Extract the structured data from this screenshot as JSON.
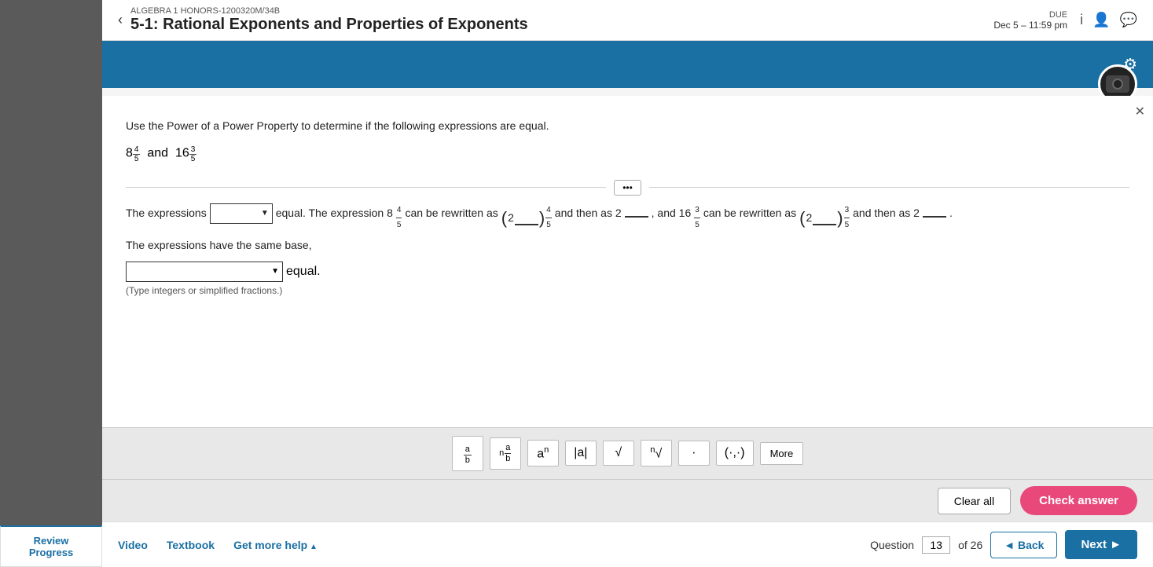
{
  "header": {
    "back_arrow": "‹",
    "subtitle": "ALGEBRA 1 HONORS-1200320M/34B",
    "title": "5-1: Rational Exponents and Properties of Exponents",
    "due_label": "DUE",
    "due_date": "Dec 5 – 11:59 pm"
  },
  "icons": {
    "info": "i",
    "profile": "👤",
    "chat": "💬",
    "gear": "⚙",
    "close": "✕"
  },
  "problem": {
    "instruction": "Use the Power of a Power Property to determine if the following expressions are equal.",
    "expression": "8^(4/5) and 16^(3/5)",
    "expression_base1": "8",
    "expression_exp1_num": "4",
    "expression_exp1_den": "5",
    "expression_and": "and",
    "expression_base2": "16",
    "expression_exp2_num": "3",
    "expression_exp2_den": "5",
    "sentence_start": "The expressions",
    "equal_label": "equal. The expression 8",
    "rewritten_label": "can be rewritten as",
    "paren_base1": "2",
    "then_as": "and then as 2",
    "and_label": ", and 16",
    "rewritten_label2": "can be rewritten as",
    "paren_base2": "2",
    "then_as2": "and then as 2",
    "same_base_note": "The expressions have the same base,",
    "second_dropdown_label": "equal.",
    "type_note": "(Type integers or simplified fractions.)"
  },
  "toolbar": {
    "buttons": [
      {
        "id": "fraction",
        "symbol": "⁴⁄₅",
        "label": "fraction"
      },
      {
        "id": "mixed",
        "symbol": "⁴⁄₅ₙ",
        "label": "mixed-number"
      },
      {
        "id": "superscript",
        "symbol": "aⁿ",
        "label": "superscript"
      },
      {
        "id": "abs",
        "symbol": "|a|",
        "label": "absolute-value"
      },
      {
        "id": "sqrt",
        "symbol": "√",
        "label": "square-root"
      },
      {
        "id": "nth-root",
        "symbol": "ⁿ√",
        "label": "nth-root"
      },
      {
        "id": "dot",
        "symbol": "·",
        "label": "dot-operator"
      },
      {
        "id": "matrix",
        "symbol": "(·,·)",
        "label": "matrix"
      },
      {
        "id": "more",
        "label": "More"
      }
    ]
  },
  "actions": {
    "clear_all_label": "Clear all",
    "check_answer_label": "Check answer"
  },
  "bottom": {
    "video_label": "Video",
    "textbook_label": "Textbook",
    "get_more_help_label": "Get more help",
    "question_label": "Question",
    "question_number": "13",
    "question_total": "of 26",
    "back_label": "◄ Back",
    "next_label": "Next ►"
  },
  "review_progress": {
    "label": "Review Progress"
  }
}
